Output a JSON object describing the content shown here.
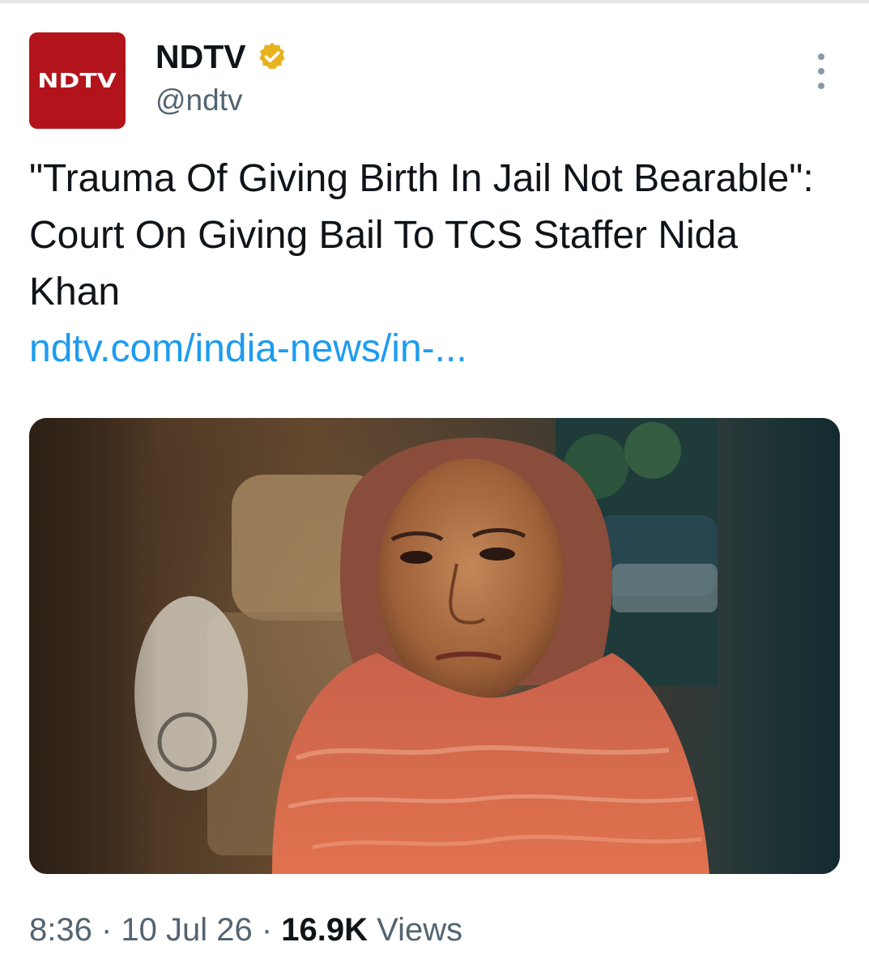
{
  "colors": {
    "brand": "#b3141b",
    "link": "#1d9bf0",
    "text_primary": "#0f1419",
    "text_secondary": "#536471",
    "verified_badge": "#e8b21e"
  },
  "author": {
    "avatar_text": "NDTV",
    "display_name": "NDTV",
    "handle": "@ndtv",
    "verified_icon": "verified-badge-icon"
  },
  "tweet": {
    "text": "\"Trauma Of Giving Birth In Jail Not Bearable\": Court On Giving Bail To TCS Staffer Nida Khan",
    "link_text": "ndtv.com/india-news/in-..."
  },
  "meta": {
    "time": "8:36",
    "sep1": " · ",
    "date": "10 Jul 26",
    "sep2": " · ",
    "views_count": "16.9K",
    "views_label": " Views"
  }
}
